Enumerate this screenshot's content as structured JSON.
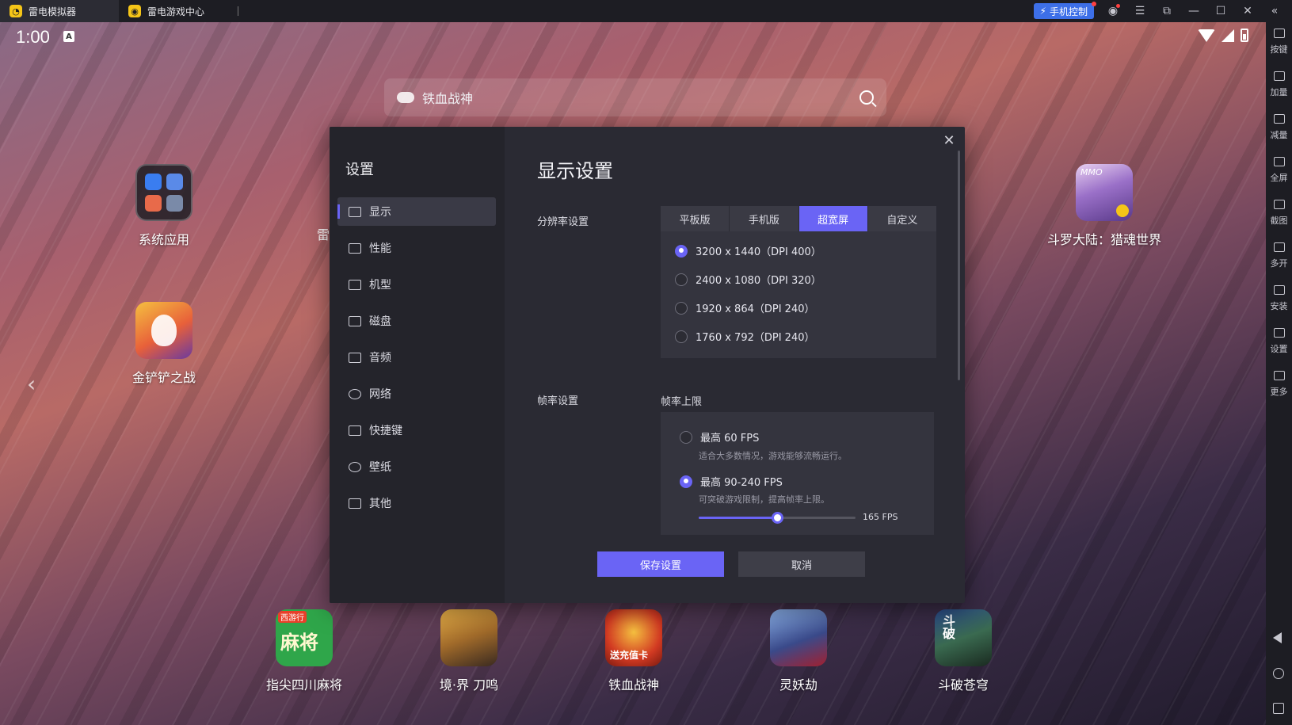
{
  "titlebar": {
    "tabs": [
      {
        "label": "雷电模拟器",
        "icon": "ldplayer-logo-icon"
      },
      {
        "label": "雷电游戏中心",
        "icon": "game-center-logo-icon"
      }
    ],
    "phone_control": "手机控制"
  },
  "status": {
    "time": "1:00",
    "badge": "A"
  },
  "search": {
    "text": "铁血战神"
  },
  "desktop_apps": {
    "system": "系统应用",
    "jinchan": "金铲铲之战",
    "douluo": "斗罗大陆：猎魂世界",
    "douluo_badge": "MMO",
    "partial_label": "雷"
  },
  "dock_apps": [
    {
      "label": "指尖四川麻将",
      "icon_text": "麻将",
      "banner": "西游行",
      "color": "#2fa64a"
    },
    {
      "label": "境·界 刀鸣",
      "color": "#c8a050"
    },
    {
      "label": "铁血战神",
      "banner": "送充值卡",
      "color": "#d23a22"
    },
    {
      "label": "灵妖劫",
      "color": "#3a4a8a"
    },
    {
      "label": "斗破苍穹",
      "icon_text": "斗破",
      "color": "#3a6a50"
    }
  ],
  "right_sidebar": [
    "按键",
    "加量",
    "减量",
    "全屏",
    "截图",
    "多开",
    "安装",
    "设置",
    "更多"
  ],
  "dialog": {
    "side_title": "设置",
    "nav": [
      "显示",
      "性能",
      "机型",
      "磁盘",
      "音频",
      "网络",
      "快捷键",
      "壁纸",
      "其他"
    ],
    "title": "显示设置",
    "resolution_label": "分辨率设置",
    "resolution_tabs": [
      "平板版",
      "手机版",
      "超宽屏",
      "自定义"
    ],
    "resolution_selected_tab": "超宽屏",
    "resolutions": [
      "3200 x 1440（DPI 400）",
      "2400 x 1080（DPI 320）",
      "1920 x 864（DPI 240）",
      "1760 x 792（DPI 240）"
    ],
    "resolution_selected_index": 0,
    "fps_label": "帧率设置",
    "fps_sub": "帧率上限",
    "fps_options": [
      {
        "title": "最高 60 FPS",
        "desc": "适合大多数情况，游戏能够流畅运行。"
      },
      {
        "title": "最高 90-240 FPS",
        "desc": "可突破游戏限制，提高帧率上限。"
      }
    ],
    "fps_selected_index": 1,
    "fps_slider": {
      "min": 90,
      "max": 240,
      "value": 165,
      "display": "165 FPS"
    },
    "save": "保存设置",
    "cancel": "取消"
  },
  "colors": {
    "accent": "#6a64f5",
    "titlebar": "#1d1d23",
    "dialog": "#2a2a33"
  }
}
